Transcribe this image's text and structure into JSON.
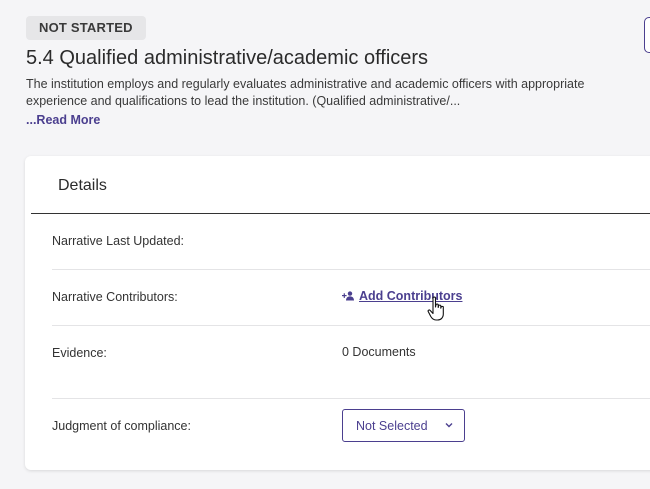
{
  "status": {
    "label": "NOT STARTED"
  },
  "standard": {
    "title": "5.4 Qualified administrative/academic officers",
    "description": "The institution employs and regularly evaluates administrative and academic officers with appropriate experience and qualifications to lead the institution. (Qualified administrative/...",
    "read_more": "...Read More"
  },
  "details": {
    "title": "Details",
    "narrative_last_updated": {
      "label": "Narrative Last Updated:",
      "value": ""
    },
    "narrative_contributors": {
      "label": "Narrative Contributors:",
      "action": "Add Contributors",
      "icon": "add-user-icon"
    },
    "evidence": {
      "label": "Evidence:",
      "value": "0 Documents"
    },
    "judgment": {
      "label": "Judgment of compliance:",
      "selected": "Not Selected"
    }
  },
  "colors": {
    "accent": "#4b3f8f",
    "badge_bg": "#e6e6e8"
  }
}
